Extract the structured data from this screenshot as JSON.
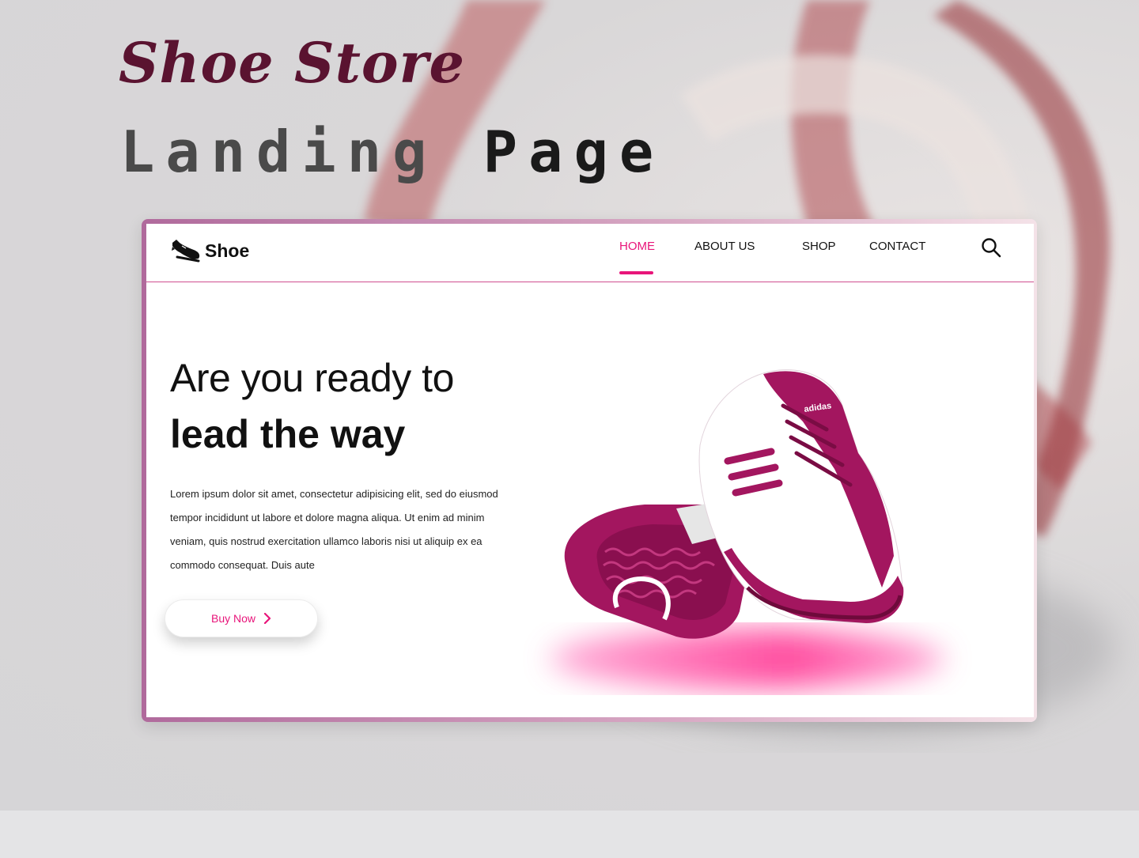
{
  "showcase": {
    "title": "Shoe Store",
    "subtitle_light": "Landing",
    "subtitle_dark": "Page"
  },
  "header": {
    "brand": "Shoe",
    "logo_icon": "shoe-icon",
    "nav": [
      {
        "label": "HOME",
        "active": true
      },
      {
        "label": "ABOUT US",
        "active": false
      },
      {
        "label": "SHOP",
        "active": false
      },
      {
        "label": "CONTACT",
        "active": false
      }
    ],
    "search_icon": "search-icon"
  },
  "hero": {
    "line_1": "Are you ready to",
    "line_2": "lead the way",
    "body": "Lorem ipsum dolor sit amet, consectetur adipisicing elit, sed do eiusmod tempor incididunt ut labore et dolore magna aliqua. Ut enim ad minim veniam, quis nostrud exercitation ullamco laboris nisi ut aliquip ex ea commodo consequat. Duis aute",
    "cta_label": "Buy Now",
    "product_logo": "adidas"
  },
  "colors": {
    "accent": "#e8157a",
    "title": "#5a1330",
    "shoe": "#a3165f"
  }
}
